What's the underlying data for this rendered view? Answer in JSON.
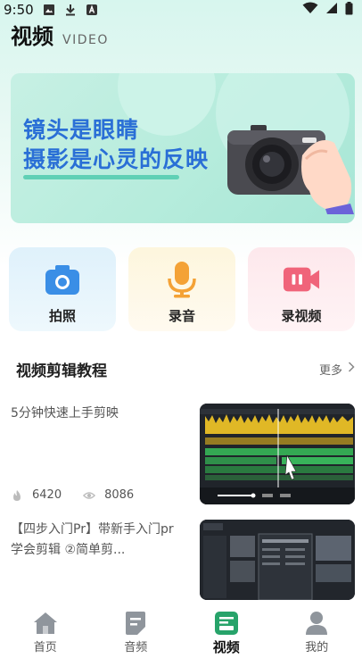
{
  "status_bar": {
    "time": "9:50"
  },
  "header": {
    "title": "视频",
    "subtitle": "VIDEO"
  },
  "banner": {
    "line1": "镜头是眼睛",
    "line2": "摄影是心灵的反映"
  },
  "actions": [
    {
      "label": "拍照",
      "icon": "camera-icon",
      "color": "#3a8ee6"
    },
    {
      "label": "录音",
      "icon": "microphone-icon",
      "color": "#f4a236"
    },
    {
      "label": "录视频",
      "icon": "video-camera-icon",
      "color": "#f0647a"
    }
  ],
  "section": {
    "title": "视频剪辑教程",
    "more": "更多"
  },
  "videos": [
    {
      "title": "5分钟快速上手剪映",
      "likes": "6420",
      "views": "8086"
    },
    {
      "title": "【四步入门Pr】带新手入门pr学会剪辑 ②简单剪..."
    }
  ],
  "nav": [
    {
      "label": "首页",
      "icon": "home-icon"
    },
    {
      "label": "音频",
      "icon": "audio-doc-icon"
    },
    {
      "label": "视频",
      "icon": "video-icon",
      "active": true
    },
    {
      "label": "我的",
      "icon": "profile-icon"
    }
  ],
  "colors": {
    "accent": "#27a36a",
    "banner_text": "#2a6fd6"
  }
}
